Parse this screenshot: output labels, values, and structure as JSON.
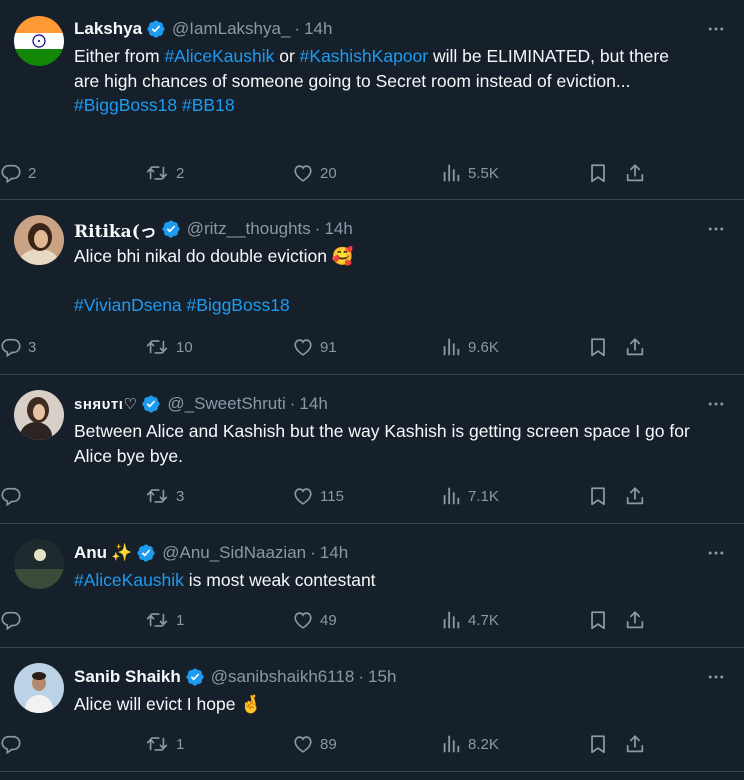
{
  "accent_color": "#1d9bf0",
  "background_color": "#15202b",
  "tweets": [
    {
      "name": "Lakshya",
      "handle": "@IamLakshya_",
      "separator": "·",
      "time": "14h",
      "text": {
        "p1": "Either from ",
        "tag1": "#AliceKaushik",
        "p2": " or ",
        "tag2": "#KashishKapoor",
        "p3": " will be ELIMINATED, but there are high chances of someone going to Secret room instead of eviction...",
        "tag3": "#BiggBoss18",
        "tag4": "#BB18"
      },
      "stats": {
        "replies": "2",
        "retweets": "2",
        "likes": "20",
        "views": "5.5K"
      }
    },
    {
      "name": "Ritikaฅ^•ﻌ•^ฅ",
      "name_display": "Ritika(っ",
      "handle": "@ritz__thoughts",
      "separator": "·",
      "time": "14h",
      "text": {
        "p1": "Alice bhi nikal do double eviction ",
        "emoji": "🥰",
        "tag1": "#VivianDsena",
        "tag2": "#BiggBoss18"
      },
      "stats": {
        "replies": "3",
        "retweets": "10",
        "likes": "91",
        "views": "9.6K"
      }
    },
    {
      "name": "ѕняυтι♡",
      "handle": "@_SweetShruti",
      "separator": "·",
      "time": "14h",
      "text": {
        "p1": "Between Alice and Kashish but the way Kashish is getting screen space I go for Alice bye bye."
      },
      "stats": {
        "replies": "",
        "retweets": "3",
        "likes": "115",
        "views": "7.1K"
      }
    },
    {
      "name": "Anu",
      "name_emoji": "✨",
      "handle": "@Anu_SidNaazian",
      "separator": "·",
      "time": "14h",
      "text": {
        "tag1": "#AliceKaushik",
        "p1": " is most weak contestant"
      },
      "stats": {
        "replies": "",
        "retweets": "1",
        "likes": "49",
        "views": "4.7K"
      }
    },
    {
      "name": "Sanib Shaikh",
      "handle": "@sanibshaikh6118",
      "separator": "·",
      "time": "15h",
      "text": {
        "p1": "Alice will evict I hope ",
        "emoji": "🤞"
      },
      "stats": {
        "replies": "",
        "retweets": "1",
        "likes": "89",
        "views": "8.2K"
      }
    }
  ]
}
